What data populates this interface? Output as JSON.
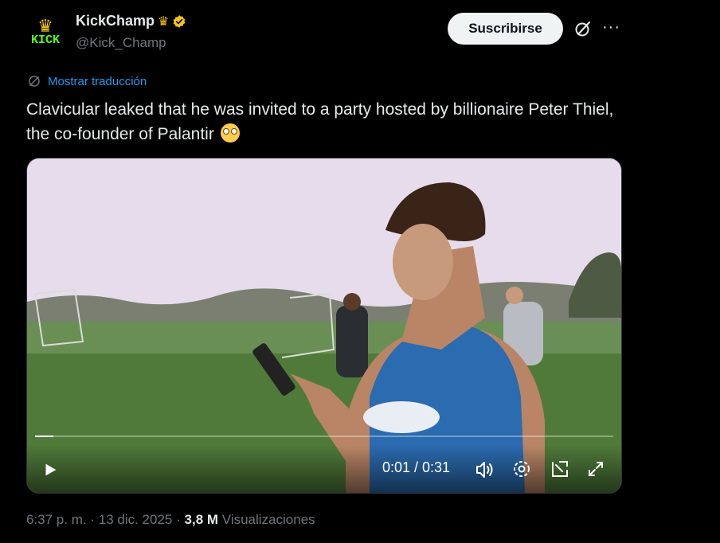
{
  "author": {
    "display_name": "KickChamp",
    "handle": "@Kick_Champ",
    "avatar_text": "KICK",
    "avatar_icon": "crown-icon",
    "name_emoji": "crown-icon",
    "badge": "verified-gold-icon"
  },
  "actions": {
    "subscribe_label": "Suscribirse",
    "grok_icon": "grok-icon",
    "more_icon": "more-icon",
    "more_glyph": "···"
  },
  "translate": {
    "icon": "globe-icon",
    "label": "Mostrar traducción"
  },
  "tweet": {
    "text": "Clavicular leaked that he was invited to a party hosted by billionaire Peter Thiel, the co-founder of Palantir",
    "emoji": "flushed-face-icon"
  },
  "video": {
    "time_display": "0:01 / 0:31",
    "progress_fraction": 0.032,
    "controls": [
      "play-icon",
      "volume-icon",
      "settings-icon",
      "pip-icon",
      "fullscreen-icon"
    ]
  },
  "meta": {
    "time": "6:37 p. m.",
    "separator": "·",
    "date": "13 dic. 2025",
    "views_count": "3,8 M",
    "views_label": "Visualizaciones"
  },
  "colors": {
    "background": "#000000",
    "text": "#e7e9ea",
    "muted": "#71767b",
    "link": "#1d9bf0",
    "button_bg": "#eff3f4",
    "verified": "#f5c518",
    "kick_green": "#53fc18"
  }
}
